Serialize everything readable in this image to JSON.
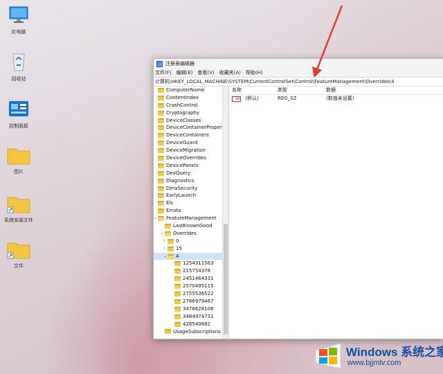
{
  "desktop": {
    "icons": [
      {
        "label": "此电脑"
      },
      {
        "label": "回收站"
      },
      {
        "label": "控制面板"
      },
      {
        "label": "图片"
      },
      {
        "label": "系统安装文件"
      },
      {
        "label": "文件"
      }
    ]
  },
  "window": {
    "title": "注册表编辑器",
    "menu": [
      "文件(F)",
      "编辑(E)",
      "查看(V)",
      "收藏夹(A)",
      "帮助(H)"
    ],
    "address": "计算机\\HKEY_LOCAL_MACHINE\\SYSTEM\\CurrentControlSet\\Control\\FeatureManagement\\Overrides\\4",
    "tree": [
      {
        "label": "ComputerName",
        "level": 0
      },
      {
        "label": "ContentIndex",
        "level": 0
      },
      {
        "label": "CrashControl",
        "level": 0
      },
      {
        "label": "Cryptography",
        "level": 0
      },
      {
        "label": "DeviceClasses",
        "level": 0
      },
      {
        "label": "DeviceContainerPropertyUpda",
        "level": 0
      },
      {
        "label": "DeviceContainers",
        "level": 0
      },
      {
        "label": "DeviceGuard",
        "level": 0
      },
      {
        "label": "DeviceMigration",
        "level": 0
      },
      {
        "label": "DeviceOverrides",
        "level": 0
      },
      {
        "label": "DevicePanels",
        "level": 0
      },
      {
        "label": "DevQuery",
        "level": 0
      },
      {
        "label": "Diagnostics",
        "level": 0
      },
      {
        "label": "DmaSecurity",
        "level": 0
      },
      {
        "label": "EarlyLaunch",
        "level": 0
      },
      {
        "label": "Els",
        "level": 0
      },
      {
        "label": "Errata",
        "level": 0
      },
      {
        "label": "FeatureManagement",
        "level": 0
      },
      {
        "label": "LastKnownGood",
        "level": 1
      },
      {
        "label": "Overrides",
        "level": 1
      },
      {
        "label": "0",
        "level": 2
      },
      {
        "label": "15",
        "level": 2
      },
      {
        "label": "4",
        "level": 2
      },
      {
        "label": "1254311563",
        "level": 3
      },
      {
        "label": "215754378",
        "level": 3
      },
      {
        "label": "2451464331",
        "level": 3
      },
      {
        "label": "2570495115",
        "level": 3
      },
      {
        "label": "2755536522",
        "level": 3
      },
      {
        "label": "2786979467",
        "level": 3
      },
      {
        "label": "3476628106",
        "level": 3
      },
      {
        "label": "3484974731",
        "level": 3
      },
      {
        "label": "426540682",
        "level": 3
      },
      {
        "label": "UsageSubscriptions",
        "level": 1
      }
    ],
    "columns": [
      "名称",
      "类型",
      "数据"
    ],
    "values": [
      {
        "name": "(默认)",
        "type": "REG_SZ",
        "data": "(数值未设置)"
      }
    ]
  },
  "watermark": {
    "brand": "Windows 系统之家",
    "site": "www.bjjmlv.com"
  }
}
